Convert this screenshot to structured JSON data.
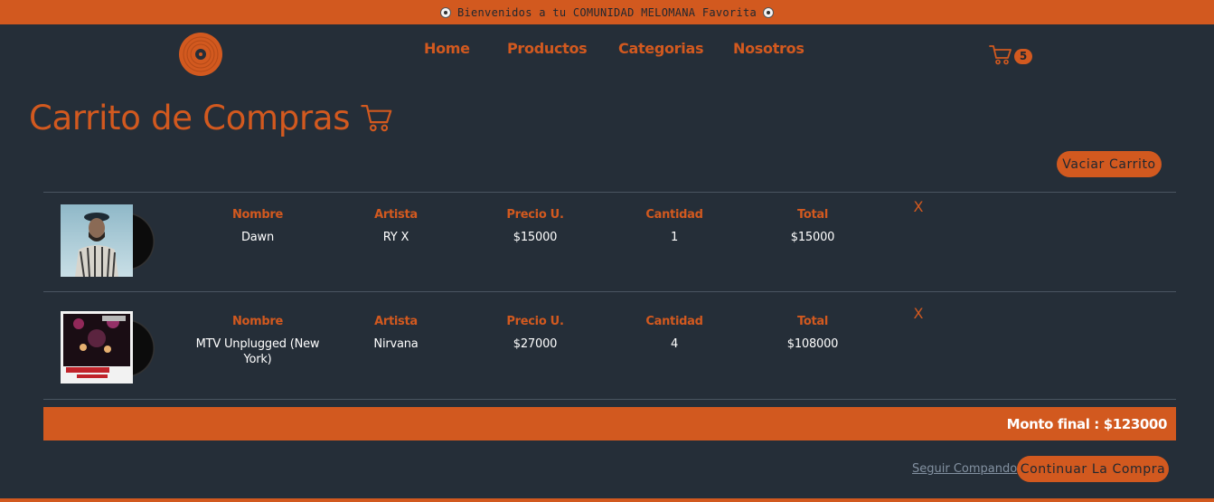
{
  "announcement": {
    "text": "Bienvenidos a tu COMUNIDAD MELOMANA Favorita"
  },
  "nav": {
    "items": [
      {
        "label": "Home"
      },
      {
        "label": "Productos"
      },
      {
        "label": "Categorias"
      },
      {
        "label": "Nosotros"
      }
    ],
    "cart_count": "5"
  },
  "page": {
    "title": "Carrito de Compras"
  },
  "actions": {
    "clear_cart": "Vaciar Carrito",
    "keep_shopping": "Seguir Compando",
    "continue_purchase": "Continuar La Compra"
  },
  "cart": {
    "headers": {
      "name": "Nombre",
      "artist": "Artista",
      "unit_price": "Precio U.",
      "quantity": "Cantidad",
      "total": "Total"
    },
    "remove_symbol": "X",
    "items": [
      {
        "name": "Dawn",
        "artist": "RY X",
        "unit_price": "$15000",
        "quantity": "1",
        "total": "$15000"
      },
      {
        "name": "MTV Unplugged (New York)",
        "artist": "Nirvana",
        "unit_price": "$27000",
        "quantity": "4",
        "total": "$108000"
      }
    ],
    "final_amount": "Monto final : $123000"
  },
  "colors": {
    "accent": "#d2591f",
    "background": "#252e38",
    "link": "#8391a1"
  }
}
